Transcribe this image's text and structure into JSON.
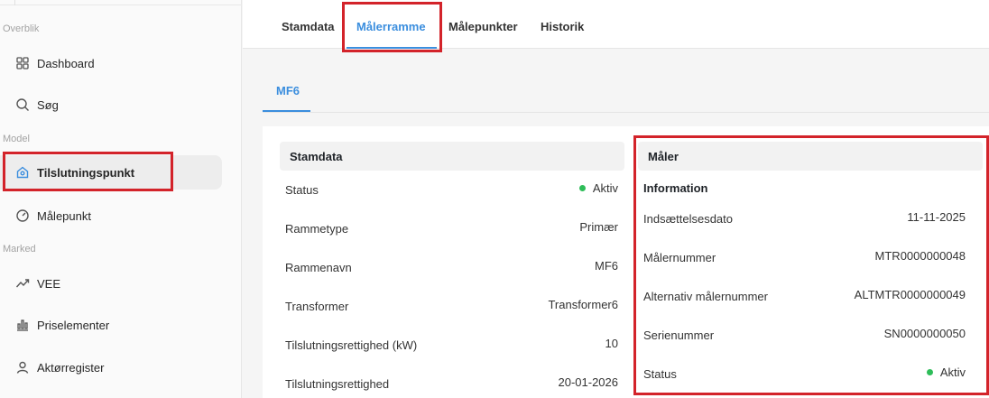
{
  "sidebar": {
    "sections": [
      "Overblik",
      "Model",
      "Marked"
    ],
    "items": [
      {
        "label": "Dashboard",
        "icon": "grid-icon"
      },
      {
        "label": "Søg",
        "icon": "search-icon"
      },
      {
        "label": "Tilslutningspunkt",
        "icon": "home-location-icon",
        "active": true
      },
      {
        "label": "Målepunkt",
        "icon": "gauge-icon"
      },
      {
        "label": "VEE",
        "icon": "trend-icon"
      },
      {
        "label": "Priselementer",
        "icon": "price-chart-icon"
      },
      {
        "label": "Aktørregister",
        "icon": "user-icon"
      }
    ]
  },
  "tabs": [
    {
      "label": "Stamdata"
    },
    {
      "label": "Målerramme",
      "active": true
    },
    {
      "label": "Målepunkter"
    },
    {
      "label": "Historik"
    }
  ],
  "subtab": {
    "label": "MF6"
  },
  "stamdata": {
    "title": "Stamdata",
    "rows": [
      {
        "label": "Status",
        "value": "Aktiv"
      },
      {
        "label": "Rammetype",
        "value": "Primær"
      },
      {
        "label": "Rammenavn",
        "value": "MF6"
      },
      {
        "label": "Transformer",
        "value": "Transformer6"
      },
      {
        "label": "Tilslutningsrettighed (kW)",
        "value": "10"
      },
      {
        "label": "Tilslutningsrettighed",
        "value": "20-01-2026"
      }
    ]
  },
  "maaler": {
    "title": "Måler",
    "section_title": "Information",
    "rows": [
      {
        "label": "Indsættelsesdato",
        "value": "11-11-2025"
      },
      {
        "label": "Målernummer",
        "value": "MTR0000000048"
      },
      {
        "label": "Alternativ målernummer",
        "value": "ALTMTR0000000049"
      },
      {
        "label": "Serienummer",
        "value": "SN0000000050"
      },
      {
        "label": "Status",
        "value": "Aktiv"
      }
    ]
  },
  "colors": {
    "accent": "#3b8ede",
    "highlight": "#d3232a",
    "status_active": "#2ebd59"
  }
}
